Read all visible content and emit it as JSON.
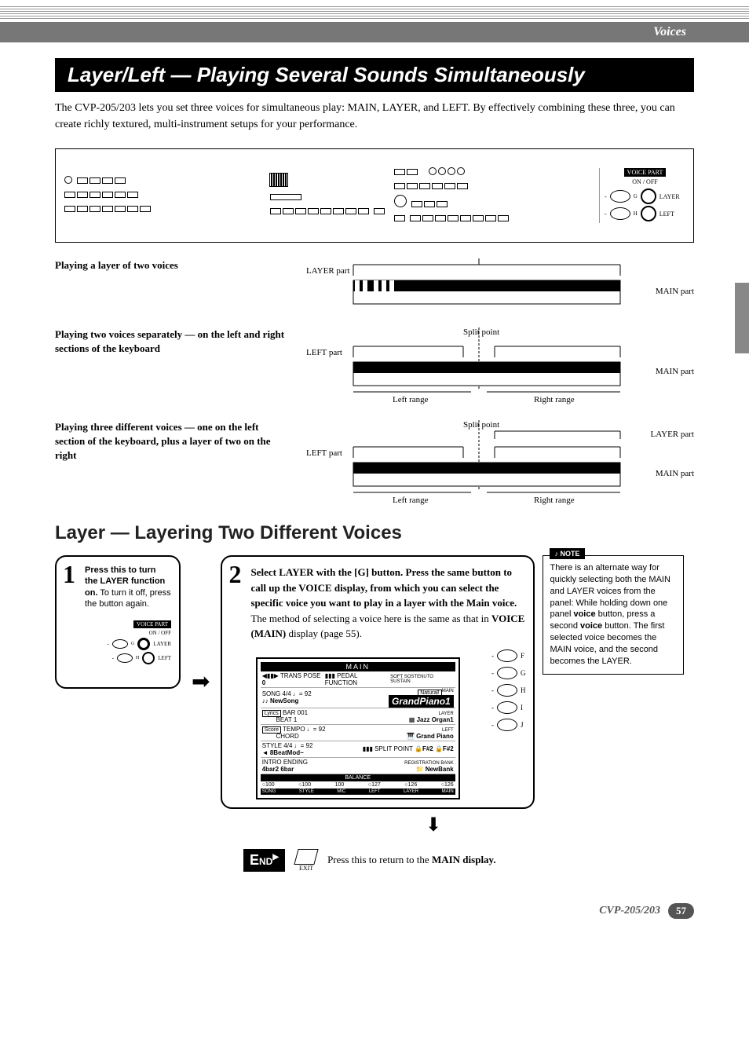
{
  "header": {
    "category": "Voices"
  },
  "section_title": "Layer/Left — Playing Several Sounds Simultaneously",
  "intro": "The CVP-205/203 lets you set three voices for simultaneous play: MAIN, LAYER, and LEFT. By effectively combining these three, you can create richly textured, multi-instrument setups for your performance.",
  "callout": {
    "title": "VOICE PART",
    "sub": "ON / OFF",
    "g_label": "G",
    "g_name": "LAYER",
    "h_label": "H",
    "h_name": "LEFT"
  },
  "scenarios": {
    "s1": {
      "heading": "Playing a layer of two voices",
      "layer_label": "LAYER part",
      "main_label": "MAIN part"
    },
    "s2": {
      "heading": "Playing two voices separately — on the left and right sections of the keyboard",
      "split_label": "Split point",
      "left_label": "LEFT part",
      "main_label": "MAIN part",
      "left_range": "Left range",
      "right_range": "Right range"
    },
    "s3": {
      "heading": "Playing three different voices — one on the left section of the keyboard, plus a layer of two on the right",
      "split_label": "Split point",
      "left_label": "LEFT part",
      "layer_label": "LAYER part",
      "main_label": "MAIN part",
      "left_range": "Left range",
      "right_range": "Right range"
    }
  },
  "sub_heading": "Layer — Layering Two Different Voices",
  "step1": {
    "num": "1",
    "text_bold": "Press this to turn the LAYER function on.",
    "text_rest": " To turn it off, press the button again.",
    "diag": {
      "title": "VOICE PART",
      "sub": "ON / OFF",
      "g": "G",
      "layer": "LAYER",
      "h": "H",
      "left": "LEFT"
    }
  },
  "step2": {
    "num": "2",
    "text_bold1": "Select LAYER with the [G] button. Press the same button to call up the VOICE display, from which you can select the specific voice you want to play in a layer with the Main voice.",
    "text_mid": " The method of selecting a voice here is the same as that in ",
    "text_bold2": "VOICE (MAIN)",
    "text_end": " display (page 55).",
    "lcd": {
      "title": "MAIN",
      "trans": "TRANS POSE",
      "trans_val": "0",
      "pedal": "PEDAL FUNCTION",
      "pedal_right": "SOFT SOSTENUTO SUSTAIN",
      "song": "SONG",
      "tempo1": "4/4 ♩= 92",
      "newsong": "♪♪ NewSong",
      "natural_tag": "Natural!",
      "main_tag": "MAIN",
      "main_voice": "GrandPiano1",
      "lyrics": "Lyrics",
      "bar": "BAR",
      "bar_val": "001",
      "beat": "BEAT",
      "beat_val": "1",
      "layer_tag": "LAYER",
      "layer_voice": "Jazz Organ1",
      "score": "Score",
      "tempo": "TEMPO ♩= 92",
      "chord": "CHORD",
      "left_tag": "LEFT",
      "left_voice": "Grand Piano",
      "style": "STYLE",
      "style_tempo": "4/4 ♩= 92",
      "style_name": "8BeatMod~",
      "split": "SPLIT POINT",
      "split_a": "F#2",
      "split_b": "F#2",
      "intro": "INTRO",
      "intro_val": "4bar2",
      "ending": "ENDING",
      "ending_val": "6bar",
      "regbank": "REGISTRATION BANK",
      "regbank_val": "NewBank",
      "balance": "BALANCE",
      "bal_vals": [
        "100",
        "100",
        "100",
        "127",
        "126",
        "126"
      ],
      "bal_labels": [
        "SONG",
        "STYLE",
        "MIC",
        "LEFT",
        "LAYER",
        "MAIN"
      ],
      "side_btns": [
        "F",
        "G",
        "H",
        "I",
        "J"
      ]
    }
  },
  "note": {
    "label": "NOTE",
    "text_pre": "There is an alternate way for quickly selecting both the MAIN and LAYER voices from the panel: While holding down one panel ",
    "voice1": "voice",
    "text_mid": " button, press a second ",
    "voice2": "voice",
    "text_post": " button. The first selected voice becomes the MAIN voice, and the second becomes the LAYER."
  },
  "end": {
    "label": "END",
    "exit": "EXIT",
    "text_bold": "Press this to return to the MAIN display.",
    "text_pre": "Press this to return to the ",
    "text_b": "MAIN display."
  },
  "footer": {
    "model": "CVP-205/203",
    "page": "57"
  }
}
